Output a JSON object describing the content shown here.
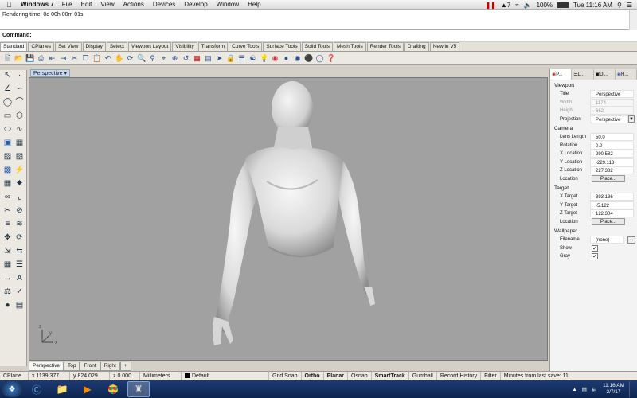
{
  "menubar": {
    "app_name": "Windows 7",
    "items": [
      "File",
      "Edit",
      "View",
      "Actions",
      "Devices",
      "Develop",
      "Window",
      "Help"
    ],
    "battery": "100%",
    "clock": "Tue 11:16 AM",
    "tray_number": "7"
  },
  "history": {
    "line1": "Rendering time: 0d 00h 00m 01s"
  },
  "command": {
    "label": "Command:"
  },
  "toolbar_tabs": [
    "Standard",
    "CPlanes",
    "Set View",
    "Display",
    "Select",
    "Viewport Layout",
    "Visibility",
    "Transform",
    "Curve Tools",
    "Surface Tools",
    "Solid Tools",
    "Mesh Tools",
    "Render Tools",
    "Drafting",
    "New in V5"
  ],
  "viewport": {
    "label": "Perspective"
  },
  "view_tabs": [
    "Perspective",
    "Top",
    "Front",
    "Right",
    "+"
  ],
  "properties": {
    "tabs": [
      "P...",
      "L...",
      "Di...",
      "H..."
    ],
    "section_viewport": "Viewport",
    "title_label": "Title",
    "title_value": "Perspective",
    "width_label": "Width",
    "width_value": "1174",
    "height_label": "Height",
    "height_value": "662",
    "projection_label": "Projection",
    "projection_value": "Perspective",
    "section_camera": "Camera",
    "lens_label": "Lens Length",
    "lens_value": "50.0",
    "rotation_label": "Rotation",
    "rotation_value": "0.0",
    "xloc_label": "X Location",
    "xloc_value": "290.582",
    "yloc_label": "Y Location",
    "yloc_value": "-229.113",
    "zloc_label": "Z Location",
    "zloc_value": "227.382",
    "location_label": "Location",
    "place_button": "Place...",
    "section_target": "Target",
    "xtarget_label": "X Target",
    "xtarget_value": "393.136",
    "ytarget_label": "Y Target",
    "ytarget_value": "-5.122",
    "ztarget_label": "Z Target",
    "ztarget_value": "122.304",
    "tlocation_label": "Location",
    "tplace_button": "Place...",
    "section_wallpaper": "Wallpaper",
    "filename_label": "Filename",
    "filename_value": "(none)",
    "show_label": "Show",
    "gray_label": "Gray",
    "browse_button": "..."
  },
  "status": {
    "cplane": "CPlane",
    "x": "x 1139.377",
    "y": "y 824.029",
    "z": "z 0.000",
    "units": "Millimeters",
    "layer": "Default",
    "grid_snap": "Grid Snap",
    "ortho": "Ortho",
    "planar": "Planar",
    "osnap": "Osnap",
    "smarttrack": "SmartTrack",
    "gumball": "Gumball",
    "record_history": "Record History",
    "filter": "Filter",
    "last_save": "Minutes from last save: 11"
  },
  "taskbar": {
    "time": "11:16 AM",
    "date": "2/7/17"
  }
}
